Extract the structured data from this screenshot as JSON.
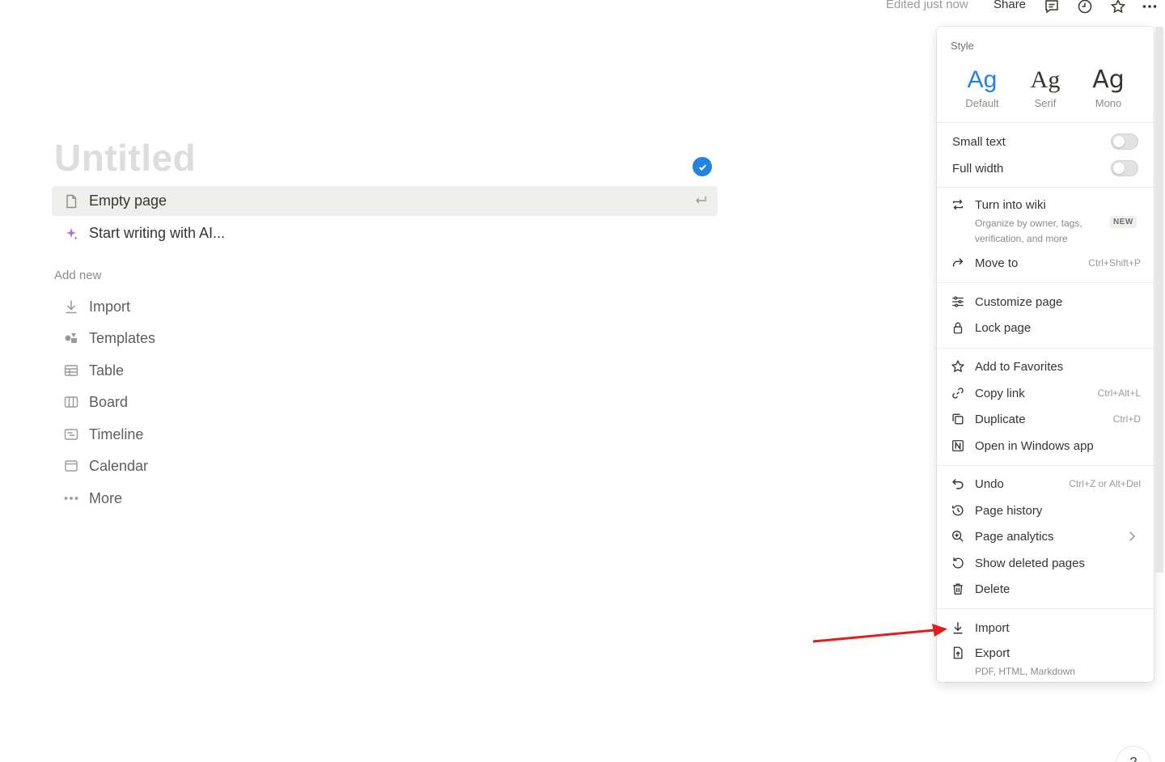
{
  "topbar": {
    "edited": "Edited just now",
    "share": "Share",
    "icons": [
      "comment-icon",
      "clock-icon",
      "star-icon",
      "more-icon"
    ]
  },
  "page": {
    "title": "Untitled",
    "options": [
      {
        "label": "Empty page",
        "icon": "page-icon",
        "selected": true
      },
      {
        "label": "Start writing with AI...",
        "icon": "sparkle-icon",
        "selected": false
      }
    ],
    "add_new_label": "Add new",
    "add_new": [
      {
        "label": "Import",
        "icon": "download-icon"
      },
      {
        "label": "Templates",
        "icon": "templates-icon"
      },
      {
        "label": "Table",
        "icon": "table-icon"
      },
      {
        "label": "Board",
        "icon": "board-icon"
      },
      {
        "label": "Timeline",
        "icon": "timeline-icon"
      },
      {
        "label": "Calendar",
        "icon": "calendar-icon"
      },
      {
        "label": "More",
        "icon": "more-icon"
      }
    ]
  },
  "menu": {
    "style_label": "Style",
    "fonts": [
      {
        "glyph": "Ag",
        "label": "Default",
        "active": true
      },
      {
        "glyph": "Ag",
        "label": "Serif",
        "active": false
      },
      {
        "glyph": "Ag",
        "label": "Mono",
        "active": false
      }
    ],
    "toggles": [
      {
        "label": "Small text",
        "on": false
      },
      {
        "label": "Full width",
        "on": false
      }
    ],
    "turn_into_wiki": {
      "label": "Turn into wiki",
      "sub1": "Organize by owner, tags,",
      "sub2": "verification, and more",
      "badge": "NEW"
    },
    "move_to": {
      "label": "Move to",
      "shortcut": "Ctrl+Shift+P"
    },
    "customize": "Customize page",
    "lock": "Lock page",
    "favorites": "Add to Favorites",
    "copy_link": {
      "label": "Copy link",
      "shortcut": "Ctrl+Alt+L"
    },
    "duplicate": {
      "label": "Duplicate",
      "shortcut": "Ctrl+D"
    },
    "open_windows": "Open in Windows app",
    "undo": {
      "label": "Undo",
      "shortcut": "Ctrl+Z or Alt+Del"
    },
    "page_history": "Page history",
    "page_analytics": "Page analytics",
    "show_deleted": "Show deleted pages",
    "delete": "Delete",
    "import": "Import",
    "export": {
      "label": "Export",
      "sub": "PDF, HTML, Markdown"
    }
  },
  "help": "?",
  "colors": {
    "accent": "#2383e2",
    "arrow": "#e11d1d",
    "text": "#37352f",
    "muted": "#9b9a97"
  }
}
